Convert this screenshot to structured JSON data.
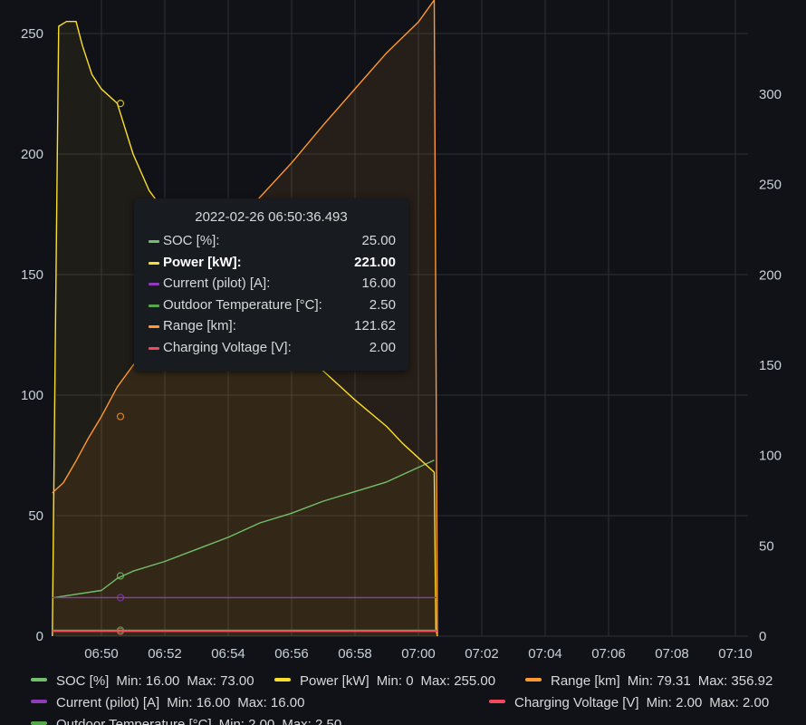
{
  "chart_data": {
    "type": "line",
    "x_ticks": [
      "06:50",
      "06:52",
      "06:54",
      "06:56",
      "06:58",
      "07:00",
      "07:02",
      "07:04",
      "07:06",
      "07:08",
      "07:10"
    ],
    "y_left_ticks": [
      "0",
      "50",
      "100",
      "150",
      "200",
      "250"
    ],
    "y_right_ticks": [
      "0",
      "50",
      "100",
      "150",
      "200",
      "250",
      "300"
    ],
    "y_left_range": [
      0,
      260
    ],
    "y_right_range": [
      0,
      340
    ],
    "x_range_minutes": [
      -1.55,
      10.5
    ],
    "grid": true,
    "legend_position": "bottom",
    "series": [
      {
        "name": "SOC [%]",
        "axis": "left",
        "color": "#73bf69",
        "points": [
          [
            -1.5,
            16
          ],
          [
            0,
            19
          ],
          [
            0.5,
            24
          ],
          [
            1,
            27
          ],
          [
            2,
            31
          ],
          [
            3,
            36
          ],
          [
            4,
            41
          ],
          [
            5,
            47
          ],
          [
            6,
            51
          ],
          [
            7,
            56
          ],
          [
            8,
            60
          ],
          [
            9,
            64
          ],
          [
            10,
            70
          ],
          [
            10.5,
            73
          ]
        ]
      },
      {
        "name": "Power [kW]",
        "axis": "left",
        "color": "#fade2a",
        "points": [
          [
            -1.55,
            0
          ],
          [
            -1.45,
            130
          ],
          [
            -1.35,
            253
          ],
          [
            -1.1,
            255
          ],
          [
            -0.8,
            255
          ],
          [
            -0.6,
            245
          ],
          [
            -0.3,
            233
          ],
          [
            0,
            227
          ],
          [
            0.5,
            221
          ],
          [
            1,
            200
          ],
          [
            1.5,
            185
          ],
          [
            2,
            176
          ],
          [
            2.5,
            165
          ],
          [
            3,
            155
          ],
          [
            4,
            143
          ],
          [
            5,
            132
          ],
          [
            6,
            121
          ],
          [
            7,
            110
          ],
          [
            8,
            98
          ],
          [
            9,
            87
          ],
          [
            9.5,
            80
          ],
          [
            10,
            74
          ],
          [
            10.5,
            68
          ],
          [
            10.55,
            3
          ],
          [
            10.6,
            0
          ]
        ]
      },
      {
        "name": "Current (pilot) [A]",
        "axis": "left",
        "color": "#8f3bb8",
        "points": [
          [
            -1.55,
            16
          ],
          [
            10.6,
            16
          ]
        ]
      },
      {
        "name": "Outdoor Temperature [°C]",
        "axis": "left",
        "color": "#56a64b",
        "points": [
          [
            -1.55,
            2.5
          ],
          [
            10.6,
            2.5
          ]
        ]
      },
      {
        "name": "Range [km]",
        "axis": "right",
        "color": "#ff9830",
        "points": [
          [
            -1.55,
            79.31
          ],
          [
            -1.2,
            85
          ],
          [
            -0.8,
            97
          ],
          [
            -0.4,
            110
          ],
          [
            0,
            121.62
          ],
          [
            0.5,
            138
          ],
          [
            1,
            150
          ],
          [
            2,
            170
          ],
          [
            3,
            193
          ],
          [
            4,
            220
          ],
          [
            5,
            243
          ],
          [
            6,
            262
          ],
          [
            7,
            283
          ],
          [
            8,
            303
          ],
          [
            9,
            323
          ],
          [
            10,
            340
          ],
          [
            10.5,
            356.92
          ],
          [
            10.6,
            0
          ]
        ]
      },
      {
        "name": "Charging Voltage [V]",
        "axis": "left",
        "color": "#f2495c",
        "points": [
          [
            -1.55,
            2
          ],
          [
            10.6,
            2
          ]
        ]
      }
    ]
  },
  "tooltip": {
    "time": "2022-02-26 06:50:36.493",
    "rows": [
      {
        "label": "SOC [%]:",
        "value": "25.00",
        "color": "#73bf69",
        "bold": false
      },
      {
        "label": "Power [kW]:",
        "value": "221.00",
        "color": "#fade2a",
        "bold": true
      },
      {
        "label": "Current (pilot) [A]:",
        "value": "16.00",
        "color": "#8f3bb8",
        "bold": false
      },
      {
        "label": "Outdoor Temperature [°C]:",
        "value": "2.50",
        "color": "#56a64b",
        "bold": false
      },
      {
        "label": "Range [km]:",
        "value": "121.62",
        "color": "#ff9830",
        "bold": false
      },
      {
        "label": "Charging Voltage [V]:",
        "value": "2.00",
        "color": "#f2495c",
        "bold": false
      }
    ]
  },
  "legend": {
    "items": [
      {
        "name": "SOC [%]",
        "color": "#73bf69",
        "min": "Min: 16.00",
        "max": "Max: 73.00"
      },
      {
        "name": "Power [kW]",
        "color": "#fade2a",
        "min": "Min: 0",
        "max": "Max: 255.00"
      },
      {
        "name": "Range [km]",
        "color": "#ff9830",
        "min": "Min: 79.31",
        "max": "Max: 356.92"
      },
      {
        "name": "Current (pilot) [A]",
        "color": "#8f3bb8",
        "min": "Min: 16.00",
        "max": "Max: 16.00"
      },
      {
        "name": "Charging Voltage [V]",
        "color": "#f2495c",
        "min": "Min: 2.00",
        "max": "Max: 2.00"
      },
      {
        "name": "Outdoor Temperature [°C]",
        "color": "#56a64b",
        "min": "Min: 2.00",
        "max": "Max: 2.50"
      }
    ]
  }
}
